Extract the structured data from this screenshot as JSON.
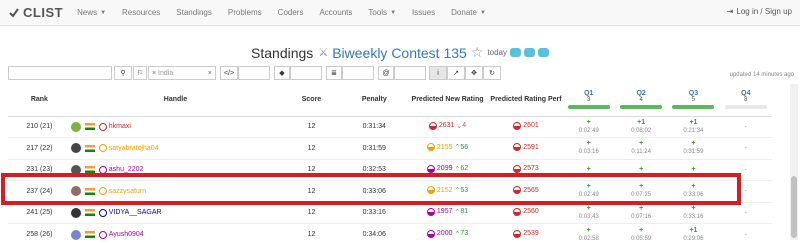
{
  "nav": {
    "logo": "CLIST",
    "items": [
      {
        "label": "News",
        "caret": true
      },
      {
        "label": "Resources",
        "caret": false
      },
      {
        "label": "Standings",
        "caret": false
      },
      {
        "label": "Problems",
        "caret": false
      },
      {
        "label": "Coders",
        "caret": false
      },
      {
        "label": "Accounts",
        "caret": false
      },
      {
        "label": "Tools",
        "caret": true
      },
      {
        "label": "Issues",
        "caret": false
      },
      {
        "label": "Donate",
        "caret": true
      }
    ],
    "login": "Log in / Sign up"
  },
  "header": {
    "prefix": "Standings",
    "contest": "Biweekly Contest 135",
    "today": "today"
  },
  "filters": {
    "country": "India",
    "updated": "updated 14 minutes ago"
  },
  "table": {
    "headers": {
      "rank": "Rank",
      "handle": "Handle",
      "score": "Score",
      "penalty": "Penalty",
      "new_rating": "Predicted New Rating",
      "perf": "Predicted Rating Perf"
    },
    "questions": [
      {
        "label": "Q1",
        "points": "3",
        "solved": true
      },
      {
        "label": "Q2",
        "points": "4",
        "solved": true
      },
      {
        "label": "Q3",
        "points": "5",
        "solved": true
      },
      {
        "label": "Q4",
        "points": "8",
        "solved": false
      }
    ],
    "rows": [
      {
        "rank": "210 (21)",
        "handle": "hkmaxi",
        "handle_color": "#d62728",
        "avatar_color": "#7cb342",
        "score": "12",
        "penalty": "0:31:34",
        "new_rating": "2631",
        "delta": "4",
        "delta_dir": "down",
        "rating_color": "#d62728",
        "perf": "2601",
        "perf_color": "#d62728",
        "q": [
          {
            "v": "+",
            "t": "0:02:49"
          },
          {
            "v": "+1",
            "t": "0:08:02"
          },
          {
            "v": "+1",
            "t": "0:21:34"
          },
          {
            "v": "-",
            "t": ""
          }
        ]
      },
      {
        "rank": "217 (22)",
        "handle": "satyabratojha04",
        "handle_color": "#f5a000",
        "avatar_color": "#444",
        "score": "12",
        "penalty": "0:31:59",
        "new_rating": "2155",
        "delta": "56",
        "delta_dir": "up",
        "rating_color": "#f5a000",
        "perf": "2591",
        "perf_color": "#d62728",
        "q": [
          {
            "v": "+",
            "t": "0:03:16"
          },
          {
            "v": "+",
            "t": "0:11:24"
          },
          {
            "v": "+",
            "t": "0:31:59"
          },
          {
            "v": "-",
            "t": ""
          }
        ]
      },
      {
        "rank": "231 (23)",
        "handle": "ashu_2202",
        "handle_color": "#aa00aa",
        "avatar_color": "#555",
        "score": "12",
        "penalty": "0:32:53",
        "new_rating": "2099",
        "delta": "62",
        "delta_dir": "up",
        "rating_color": "#aa00aa",
        "perf": "2573",
        "perf_color": "#d62728",
        "q": [
          {
            "v": "+",
            "t": ""
          },
          {
            "v": "+",
            "t": ""
          },
          {
            "v": "+",
            "t": ""
          },
          {
            "v": "-",
            "t": ""
          }
        ]
      },
      {
        "rank": "237 (24)",
        "handle": "sazzysaturn",
        "handle_color": "#f5a000",
        "avatar_color": "#8d6e63",
        "score": "12",
        "penalty": "0:33:06",
        "new_rating": "2152",
        "delta": "53",
        "delta_dir": "up",
        "rating_color": "#f5a000",
        "perf": "2565",
        "perf_color": "#d62728",
        "q": [
          {
            "v": "+",
            "t": "0:02:49"
          },
          {
            "v": "+",
            "t": "0:07:25"
          },
          {
            "v": "+",
            "t": "0:33:06"
          },
          {
            "v": "-",
            "t": ""
          }
        ]
      },
      {
        "rank": "241 (25)",
        "handle": "VIDYA__SAGAR",
        "handle_color": "#0000cc",
        "avatar_color": "#333",
        "score": "12",
        "penalty": "0:33:16",
        "new_rating": "1957",
        "delta": "81",
        "delta_dir": "up",
        "rating_color": "#aa00aa",
        "perf": "2560",
        "perf_color": "#d62728",
        "q": [
          {
            "v": "+",
            "t": "0:03:43"
          },
          {
            "v": "+",
            "t": "0:07:16"
          },
          {
            "v": "+",
            "t": "0:33:16"
          },
          {
            "v": "-",
            "t": ""
          }
        ]
      },
      {
        "rank": "258 (26)",
        "handle": "Ayush0904",
        "handle_color": "#aa00aa",
        "avatar_color": "#7986cb",
        "score": "12",
        "penalty": "0:34:06",
        "new_rating": "2000",
        "delta": "73",
        "delta_dir": "up",
        "rating_color": "#aa00aa",
        "perf": "2539",
        "perf_color": "#d62728",
        "q": [
          {
            "v": "+",
            "t": "0:02:58"
          },
          {
            "v": "+",
            "t": "0:05:59"
          },
          {
            "v": "+1",
            "t": "0:29:06"
          },
          {
            "v": "-",
            "t": ""
          }
        ]
      }
    ]
  }
}
